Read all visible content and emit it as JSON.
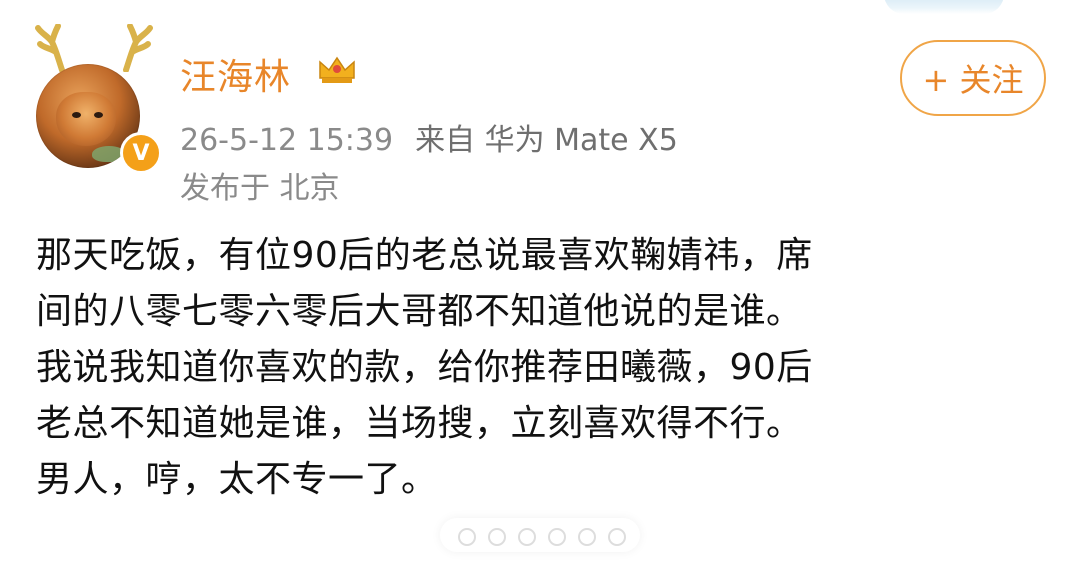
{
  "post": {
    "author": {
      "name": "汪海林",
      "verified_badge": "V",
      "crown_color": "#f2b01e"
    },
    "timestamp": "26-5-12 15:39",
    "source": "来自 华为 Mate X5",
    "location": "发布于 北京",
    "follow_label": "+ 关注",
    "text_lines": [
      "那天吃饭，有位90后的老总说最喜欢鞠婧祎，席",
      "间的八零七零六零后大哥都不知道他说的是谁。",
      "我说我知道你喜欢的款，给你推荐田曦薇，90后",
      "老总不知道她是谁，当场搜，立刻喜欢得不行。",
      "男人，哼，太不专一了。"
    ]
  },
  "colors": {
    "username": "#e8862a",
    "meta_gray": "#8a8a8a",
    "follow_border": "#f0a547",
    "verified": "#f4a019"
  },
  "icons": {
    "antlers": "antler-icon",
    "crown": "crown-icon",
    "verified": "verified-badge-icon"
  }
}
